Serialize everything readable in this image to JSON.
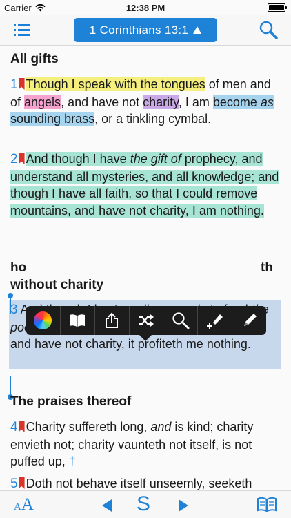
{
  "status": {
    "carrier": "Carrier",
    "time": "12:38 PM"
  },
  "nav": {
    "reference": "1 Corinthians 13:1"
  },
  "sections": [
    {
      "heading": "All gifts"
    },
    {
      "heading_partial_1": "ho",
      "heading_partial_2": "th",
      "heading_partial_3": "without charity"
    },
    {
      "heading": "The praises thereof"
    }
  ],
  "verses": {
    "v1": {
      "num": "1",
      "p1": "Though I speak with the tongues",
      "p2": " of men and of ",
      "p3": "angels",
      "p4": ", and have not ",
      "p5": "charity",
      "p6": ", I am ",
      "p7a": "become ",
      "p7b": "as",
      "p7c": " sounding brass",
      "p8": ", or a tinkling cymbal."
    },
    "v2": {
      "num": "2",
      "p1": "And though I have ",
      "p2": "the gift of",
      "p3": " prophecy, and understand all mysteries, and all knowledge; and though I have all faith, so that I could remove mountains, and have not charity, I am nothing."
    },
    "v3": {
      "num": "3",
      "p1": "  And though I bestow all my goods to feed ",
      "p2": "the poor",
      "p3": ", and though I give my body to be burned, and have not charity, it profiteth me nothing."
    },
    "v4": {
      "num": "4",
      "p1": "Charity suffereth long, ",
      "p2": "and",
      "p3": " is kind; charity envieth not; charity vaunteth not itself, is not puffed up, ",
      "dagger": "†"
    },
    "v5": {
      "num": "5",
      "p1": "Doth not behave itself unseemly, seeketh"
    }
  },
  "bottom": {
    "font_small": "A",
    "font_big": "A",
    "strongs": "S"
  },
  "colors": {
    "accent": "#1e82d7",
    "yellow": "#f5f07d",
    "pink": "#f4a3cf",
    "purple": "#c9a9e8",
    "blue": "#a6d4ef",
    "green": "#a8e4d4",
    "selection": "#c8d8ec"
  },
  "icons": [
    "wifi-icon",
    "battery-icon",
    "menu-icon",
    "search-icon",
    "color-wheel-icon",
    "book-icon",
    "share-icon",
    "shuffle-icon",
    "magnify-icon",
    "highlighter-icon",
    "pencil-icon",
    "prev-icon",
    "next-icon",
    "open-book-icon"
  ]
}
